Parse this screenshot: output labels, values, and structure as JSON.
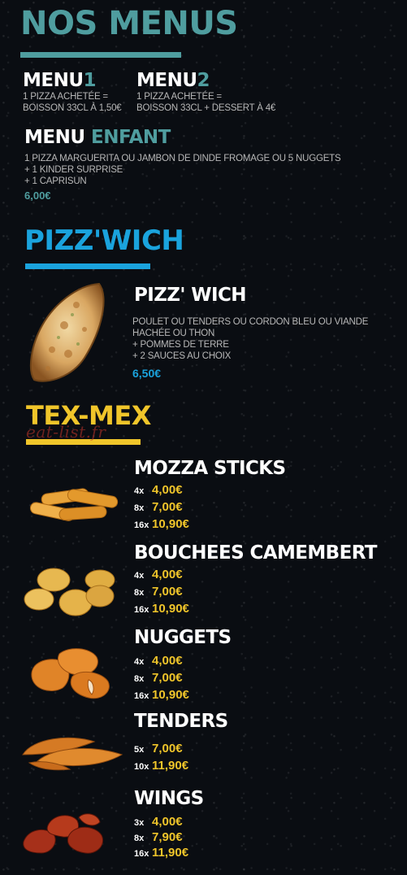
{
  "menus_section": {
    "title": "NOS MENUS",
    "menu1": {
      "label": "MENU",
      "number": "1",
      "line1": "1 PIZZA ACHETÉE =",
      "line2": "BOISSON 33CL À 1,50€"
    },
    "menu2": {
      "label": "MENU",
      "number": "2",
      "line1": "1 PIZZA ACHETÉE =",
      "line2": "BOISSON 33CL + DESSERT À 4€"
    },
    "menu_enfant": {
      "label": "MENU",
      "label2": "ENFANT",
      "line1": "1 PIZZA MARGUERITA OU JAMBON DE DINDE FROMAGE OU 5 NUGGETS",
      "line2": "+ 1 KINDER SURPRISE",
      "line3": "+ 1 CAPRISUN",
      "price": "6,00€"
    }
  },
  "pizzwich_section": {
    "title": "PIZZ'WICH",
    "item": {
      "name": "PIZZ' WICH",
      "line1": "POULET OU TENDERS OU CORDON BLEU OU VIANDE",
      "line2": "HACHÉE OU THON",
      "line3": "+ POMMES DE TERRE",
      "line4": "+ 2 SAUCES AU CHOIX",
      "price": "6,50€"
    }
  },
  "texmex_section": {
    "title": "TEX-MEX",
    "watermark": "eat-list.fr",
    "items": [
      {
        "name": "MOZZA STICKS",
        "prices": [
          {
            "qty": "4x",
            "amount": "4,00€"
          },
          {
            "qty": "8x",
            "amount": "7,00€"
          },
          {
            "qty": "16x",
            "amount": "10,90€"
          }
        ]
      },
      {
        "name": "BOUCHEES CAMEMBERT",
        "prices": [
          {
            "qty": "4x",
            "amount": "4,00€"
          },
          {
            "qty": "8x",
            "amount": "7,00€"
          },
          {
            "qty": "16x",
            "amount": "10,90€"
          }
        ]
      },
      {
        "name": "NUGGETS",
        "prices": [
          {
            "qty": "4x",
            "amount": "4,00€"
          },
          {
            "qty": "8x",
            "amount": "7,00€"
          },
          {
            "qty": "16x",
            "amount": "10,90€"
          }
        ]
      },
      {
        "name": "TENDERS",
        "prices": [
          {
            "qty": "5x",
            "amount": "7,00€"
          },
          {
            "qty": "10x",
            "amount": "11,90€"
          }
        ]
      },
      {
        "name": "WINGS",
        "prices": [
          {
            "qty": "3x",
            "amount": "4,00€"
          },
          {
            "qty": "8x",
            "amount": "7,90€"
          },
          {
            "qty": "16x",
            "amount": "11,90€"
          }
        ]
      }
    ]
  },
  "colors": {
    "teal": "#4f9d9f",
    "blue": "#1aa3dd",
    "yellow": "#f0c52a",
    "background": "#0a0d12"
  }
}
